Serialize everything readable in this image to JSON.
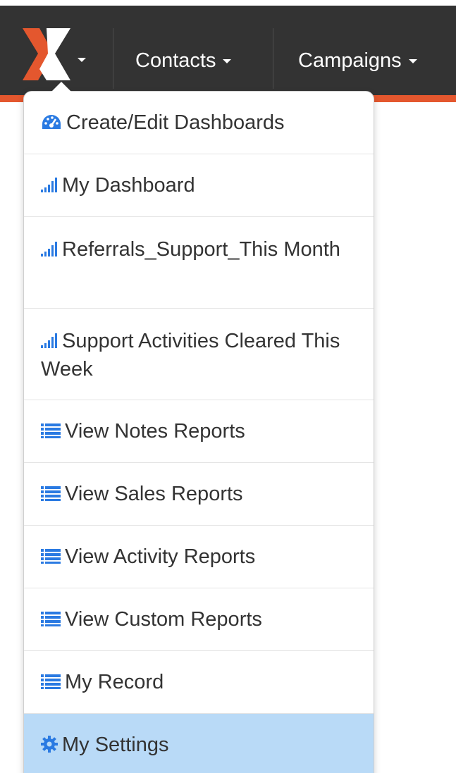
{
  "navbar": {
    "brand_icon": "x-logo",
    "items": [
      {
        "label": "Contacts",
        "icon": "caret-down-icon"
      },
      {
        "label": "Campaigns",
        "icon": "caret-down-icon"
      }
    ]
  },
  "colors": {
    "navbar_bg": "#333333",
    "accent": "#e4572e",
    "logo_orange": "#e4572e",
    "icon_blue": "#2a7ae2",
    "active_bg": "#b9daf7"
  },
  "dropdown": {
    "items": [
      {
        "label": "Create/Edit Dashboards",
        "icon": "dashboard-gauge-icon"
      },
      {
        "label": "My Dashboard",
        "icon": "signal-bars-icon"
      },
      {
        "label": "Referrals_Support_This Month",
        "icon": "signal-bars-icon"
      },
      {
        "label": "Support Activities Cleared This Week",
        "icon": "signal-bars-icon"
      },
      {
        "label": "View Notes Reports",
        "icon": "list-icon"
      },
      {
        "label": "View Sales Reports",
        "icon": "list-icon"
      },
      {
        "label": "View Activity Reports",
        "icon": "list-icon"
      },
      {
        "label": "View Custom Reports",
        "icon": "list-icon"
      },
      {
        "label": "My Record",
        "icon": "list-icon"
      },
      {
        "label": "My Settings",
        "icon": "gear-icon",
        "active": true
      }
    ]
  }
}
